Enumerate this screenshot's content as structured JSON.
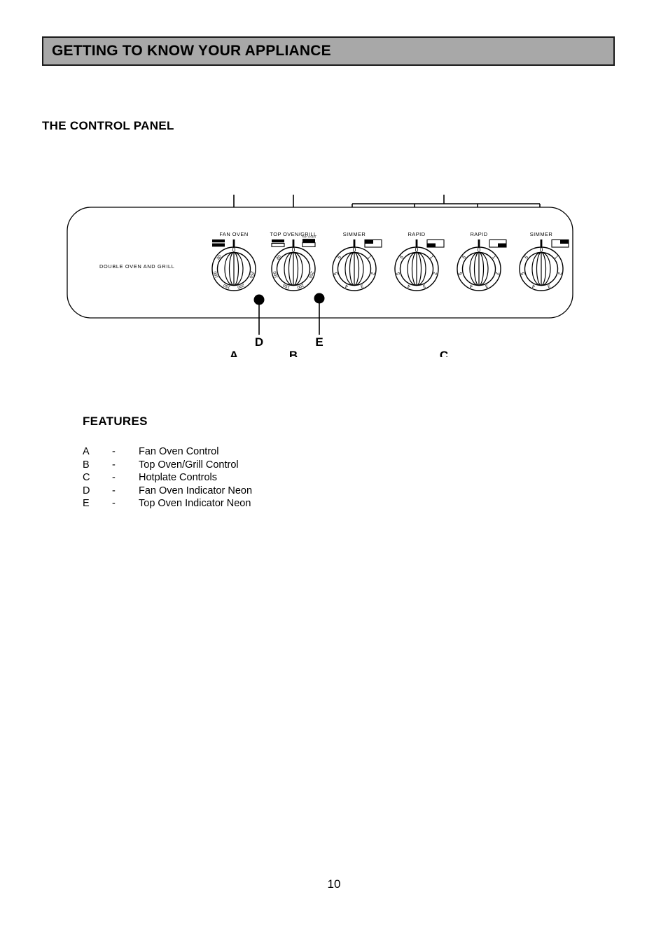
{
  "header": {
    "title": "GETTING TO KNOW YOUR APPLIANCE"
  },
  "section": {
    "heading": "THE CONTROL PANEL"
  },
  "control_panel": {
    "brand_label": "DOUBLE OVEN AND GRILL",
    "callouts": [
      {
        "id": "A",
        "label": "A"
      },
      {
        "id": "B",
        "label": "B"
      },
      {
        "id": "C",
        "label": "C"
      },
      {
        "id": "D",
        "label": "D"
      },
      {
        "id": "E",
        "label": "E"
      }
    ],
    "knobs": [
      {
        "id": "fan-oven",
        "label": "FAN OVEN",
        "zero_mark": "0",
        "dial_values": [
          "80",
          "100",
          "150",
          "200",
          "250"
        ],
        "icon": "oven-element-icon"
      },
      {
        "id": "top-oven-grill",
        "label": "TOP OVEN/GRILL",
        "zero_mark": "0",
        "dial_values": [
          "80",
          "100",
          "150",
          "200",
          "250"
        ],
        "icon_left": "grill-element-icon",
        "icon_right": "top-oven-icon",
        "icon_right_caption": "TOP OVEN"
      },
      {
        "id": "hotplate-1",
        "label": "SIMMER",
        "zero_mark": "0",
        "dial_values": [
          "6",
          "5",
          "4",
          "3",
          "2",
          "1"
        ],
        "icon": "hotplate-front-left-icon"
      },
      {
        "id": "hotplate-2",
        "label": "RAPID",
        "zero_mark": "0",
        "dial_values": [
          "6",
          "5",
          "4",
          "3",
          "2",
          "1"
        ],
        "icon": "hotplate-rear-left-icon"
      },
      {
        "id": "hotplate-3",
        "label": "RAPID",
        "zero_mark": "0",
        "dial_values": [
          "6",
          "5",
          "4",
          "3",
          "2",
          "1"
        ],
        "icon": "hotplate-rear-right-icon"
      },
      {
        "id": "hotplate-4",
        "label": "SIMMER",
        "zero_mark": "0",
        "dial_values": [
          "6",
          "5",
          "4",
          "3",
          "2",
          "1"
        ],
        "icon": "hotplate-front-right-icon"
      }
    ],
    "neons": [
      {
        "id": "fan-oven-neon",
        "callout": "D"
      },
      {
        "id": "top-oven-neon",
        "callout": "E"
      }
    ]
  },
  "features": {
    "heading": "FEATURES",
    "dash": "-",
    "items": [
      {
        "key": "A",
        "label": "Fan Oven Control"
      },
      {
        "key": "B",
        "label": "Top Oven/Grill Control"
      },
      {
        "key": "C",
        "label": "Hotplate Controls"
      },
      {
        "key": "D",
        "label": "Fan Oven Indicator Neon"
      },
      {
        "key": "E",
        "label": "Top Oven Indicator Neon"
      }
    ]
  },
  "footer": {
    "page_number": "10"
  },
  "colors": {
    "header_bg": "#a8a8a8",
    "header_border": "#1a1a1a",
    "ink": "#000000",
    "paper": "#ffffff"
  }
}
